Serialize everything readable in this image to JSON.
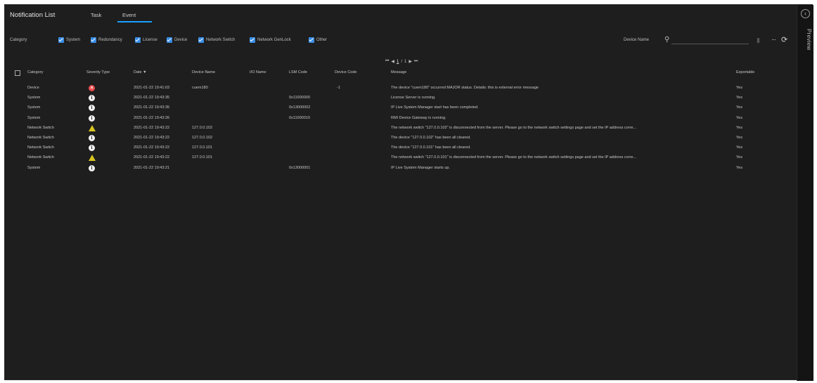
{
  "header": {
    "title": "Notification List",
    "tabs": [
      {
        "label": "Task"
      },
      {
        "label": "Event"
      }
    ],
    "active_tab": "Event"
  },
  "filters": {
    "category_label": "Category",
    "items": [
      {
        "label": "System",
        "checked": true
      },
      {
        "label": "Redundancy",
        "checked": true
      },
      {
        "label": "License",
        "checked": true
      },
      {
        "label": "Device",
        "checked": true
      },
      {
        "label": "Network Switch",
        "checked": true
      },
      {
        "label": "Network GenLock",
        "checked": true
      },
      {
        "label": "Other",
        "checked": true
      }
    ],
    "device_name_label": "Device Name",
    "device_name_value": ""
  },
  "pager": {
    "current": "1",
    "total": "1"
  },
  "table": {
    "columns": [
      "Category",
      "Severity Type",
      "Date",
      "Device Name",
      "I/O Name",
      "LSM Code",
      "Device Code",
      "Message",
      "Exportable"
    ],
    "sort_indicator": "▼",
    "rows": [
      {
        "category": "Device",
        "severity": "error",
        "date": "2021-01-22 19:41:03",
        "device": "cuem180",
        "io": "",
        "lsm": "",
        "devcode": "-1",
        "message": "The device \"cuem180\" occurred MAJOR status. Details: this is external error message",
        "exportable": "Yes"
      },
      {
        "category": "System",
        "severity": "info",
        "date": "2021-01-22 19:43:35",
        "device": "",
        "io": "",
        "lsm": "0x11000000",
        "devcode": "",
        "message": "License Server is running.",
        "exportable": "Yes"
      },
      {
        "category": "System",
        "severity": "info",
        "date": "2021-01-22 19:43:35",
        "device": "",
        "io": "",
        "lsm": "0x13000002",
        "devcode": "",
        "message": "IP Live System Manager start has been completed.",
        "exportable": "Yes"
      },
      {
        "category": "System",
        "severity": "info",
        "date": "2021-01-22 19:43:26",
        "device": "",
        "io": "",
        "lsm": "0x11000010",
        "devcode": "",
        "message": "RMI Device Gateway is running.",
        "exportable": "Yes"
      },
      {
        "category": "Network Switch",
        "severity": "warn",
        "date": "2021-01-22 19:43:22",
        "device": "127.0.0.102",
        "io": "",
        "lsm": "",
        "devcode": "",
        "message": "The network switch \"127.0.0.102\" is disconnected from the server. Please go to the network switch settings page and set the IP address corre...",
        "exportable": "Yes"
      },
      {
        "category": "Network Switch",
        "severity": "info",
        "date": "2021-01-22 19:43:22",
        "device": "127.0.0.102",
        "io": "",
        "lsm": "",
        "devcode": "",
        "message": "The device \"127.0.0.102\" has been all cleared.",
        "exportable": "Yes"
      },
      {
        "category": "Network Switch",
        "severity": "info",
        "date": "2021-01-22 19:43:22",
        "device": "127.0.0.101",
        "io": "",
        "lsm": "",
        "devcode": "",
        "message": "The device \"127.0.0.101\" has been all cleared.",
        "exportable": "Yes"
      },
      {
        "category": "Network Switch",
        "severity": "warn",
        "date": "2021-01-22 19:43:22",
        "device": "127.0.0.101",
        "io": "",
        "lsm": "",
        "devcode": "",
        "message": "The network switch \"127.0.0.101\" is disconnected from the server. Please go to the network switch settings page and set the IP address corre...",
        "exportable": "Yes"
      },
      {
        "category": "System",
        "severity": "info",
        "date": "2021-01-22 19:43:21",
        "device": "",
        "io": "",
        "lsm": "0x13000001",
        "devcode": "",
        "message": "IP Live System Manager starts up.",
        "exportable": "Yes"
      }
    ]
  },
  "sidebar": {
    "preview_label": "Preview"
  },
  "icons": {
    "error": "error-circle-icon",
    "info": "info-circle-icon",
    "warn": "warning-triangle-icon"
  },
  "colors": {
    "accent": "#1aa0ff",
    "checkbox": "#3a8ee6",
    "error": "#e84b4b",
    "warning": "#d8c520"
  }
}
